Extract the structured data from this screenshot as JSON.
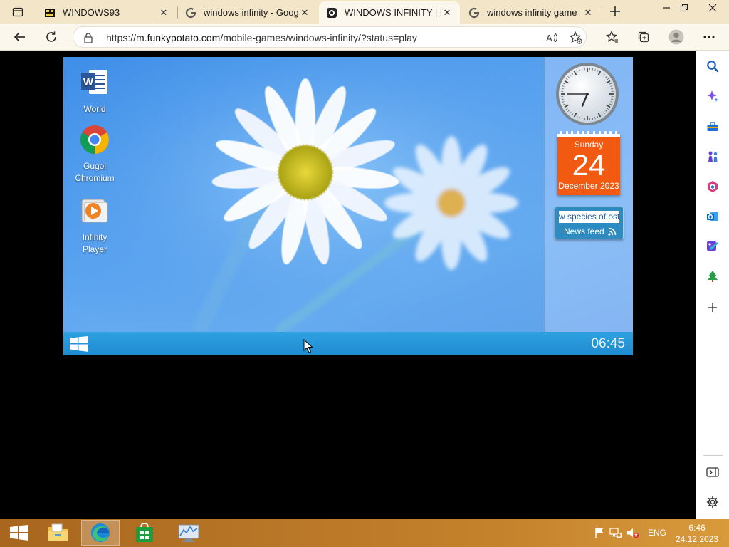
{
  "browser": {
    "tabs": [
      {
        "title": "WINDOWS93",
        "active": false
      },
      {
        "title": "windows infinity - Goog",
        "active": false
      },
      {
        "title": "WINDOWS INFINITY | F",
        "active": true
      },
      {
        "title": "windows infinity game",
        "active": false
      }
    ],
    "address": {
      "scheme": "https://",
      "host": "m.funkypotato.com",
      "path": "/mobile-games/windows-infinity/?status=play"
    }
  },
  "game": {
    "desktop_icons": [
      {
        "label": "World",
        "icon": "word-icon"
      },
      {
        "label": "Gugol Chromium",
        "icon": "chromium-icon"
      },
      {
        "label": "Infinity Player",
        "icon": "media-player-icon"
      }
    ],
    "calendar": {
      "weekday": "Sunday",
      "day": "24",
      "month": "December 2023"
    },
    "clock": {
      "hour": 6,
      "minute": 45
    },
    "news": {
      "ticker": "w species of ost",
      "label": "News feed"
    },
    "taskbar_time": "06:45"
  },
  "taskbar": {
    "language": "ENG",
    "time": "6:46",
    "date": "24.12.2023"
  },
  "colors": {
    "taskbar": "#b97728",
    "game_taskbar": "#2fa2e0",
    "calendar": "#f25a12",
    "tab_strip": "#f3e5c8"
  }
}
